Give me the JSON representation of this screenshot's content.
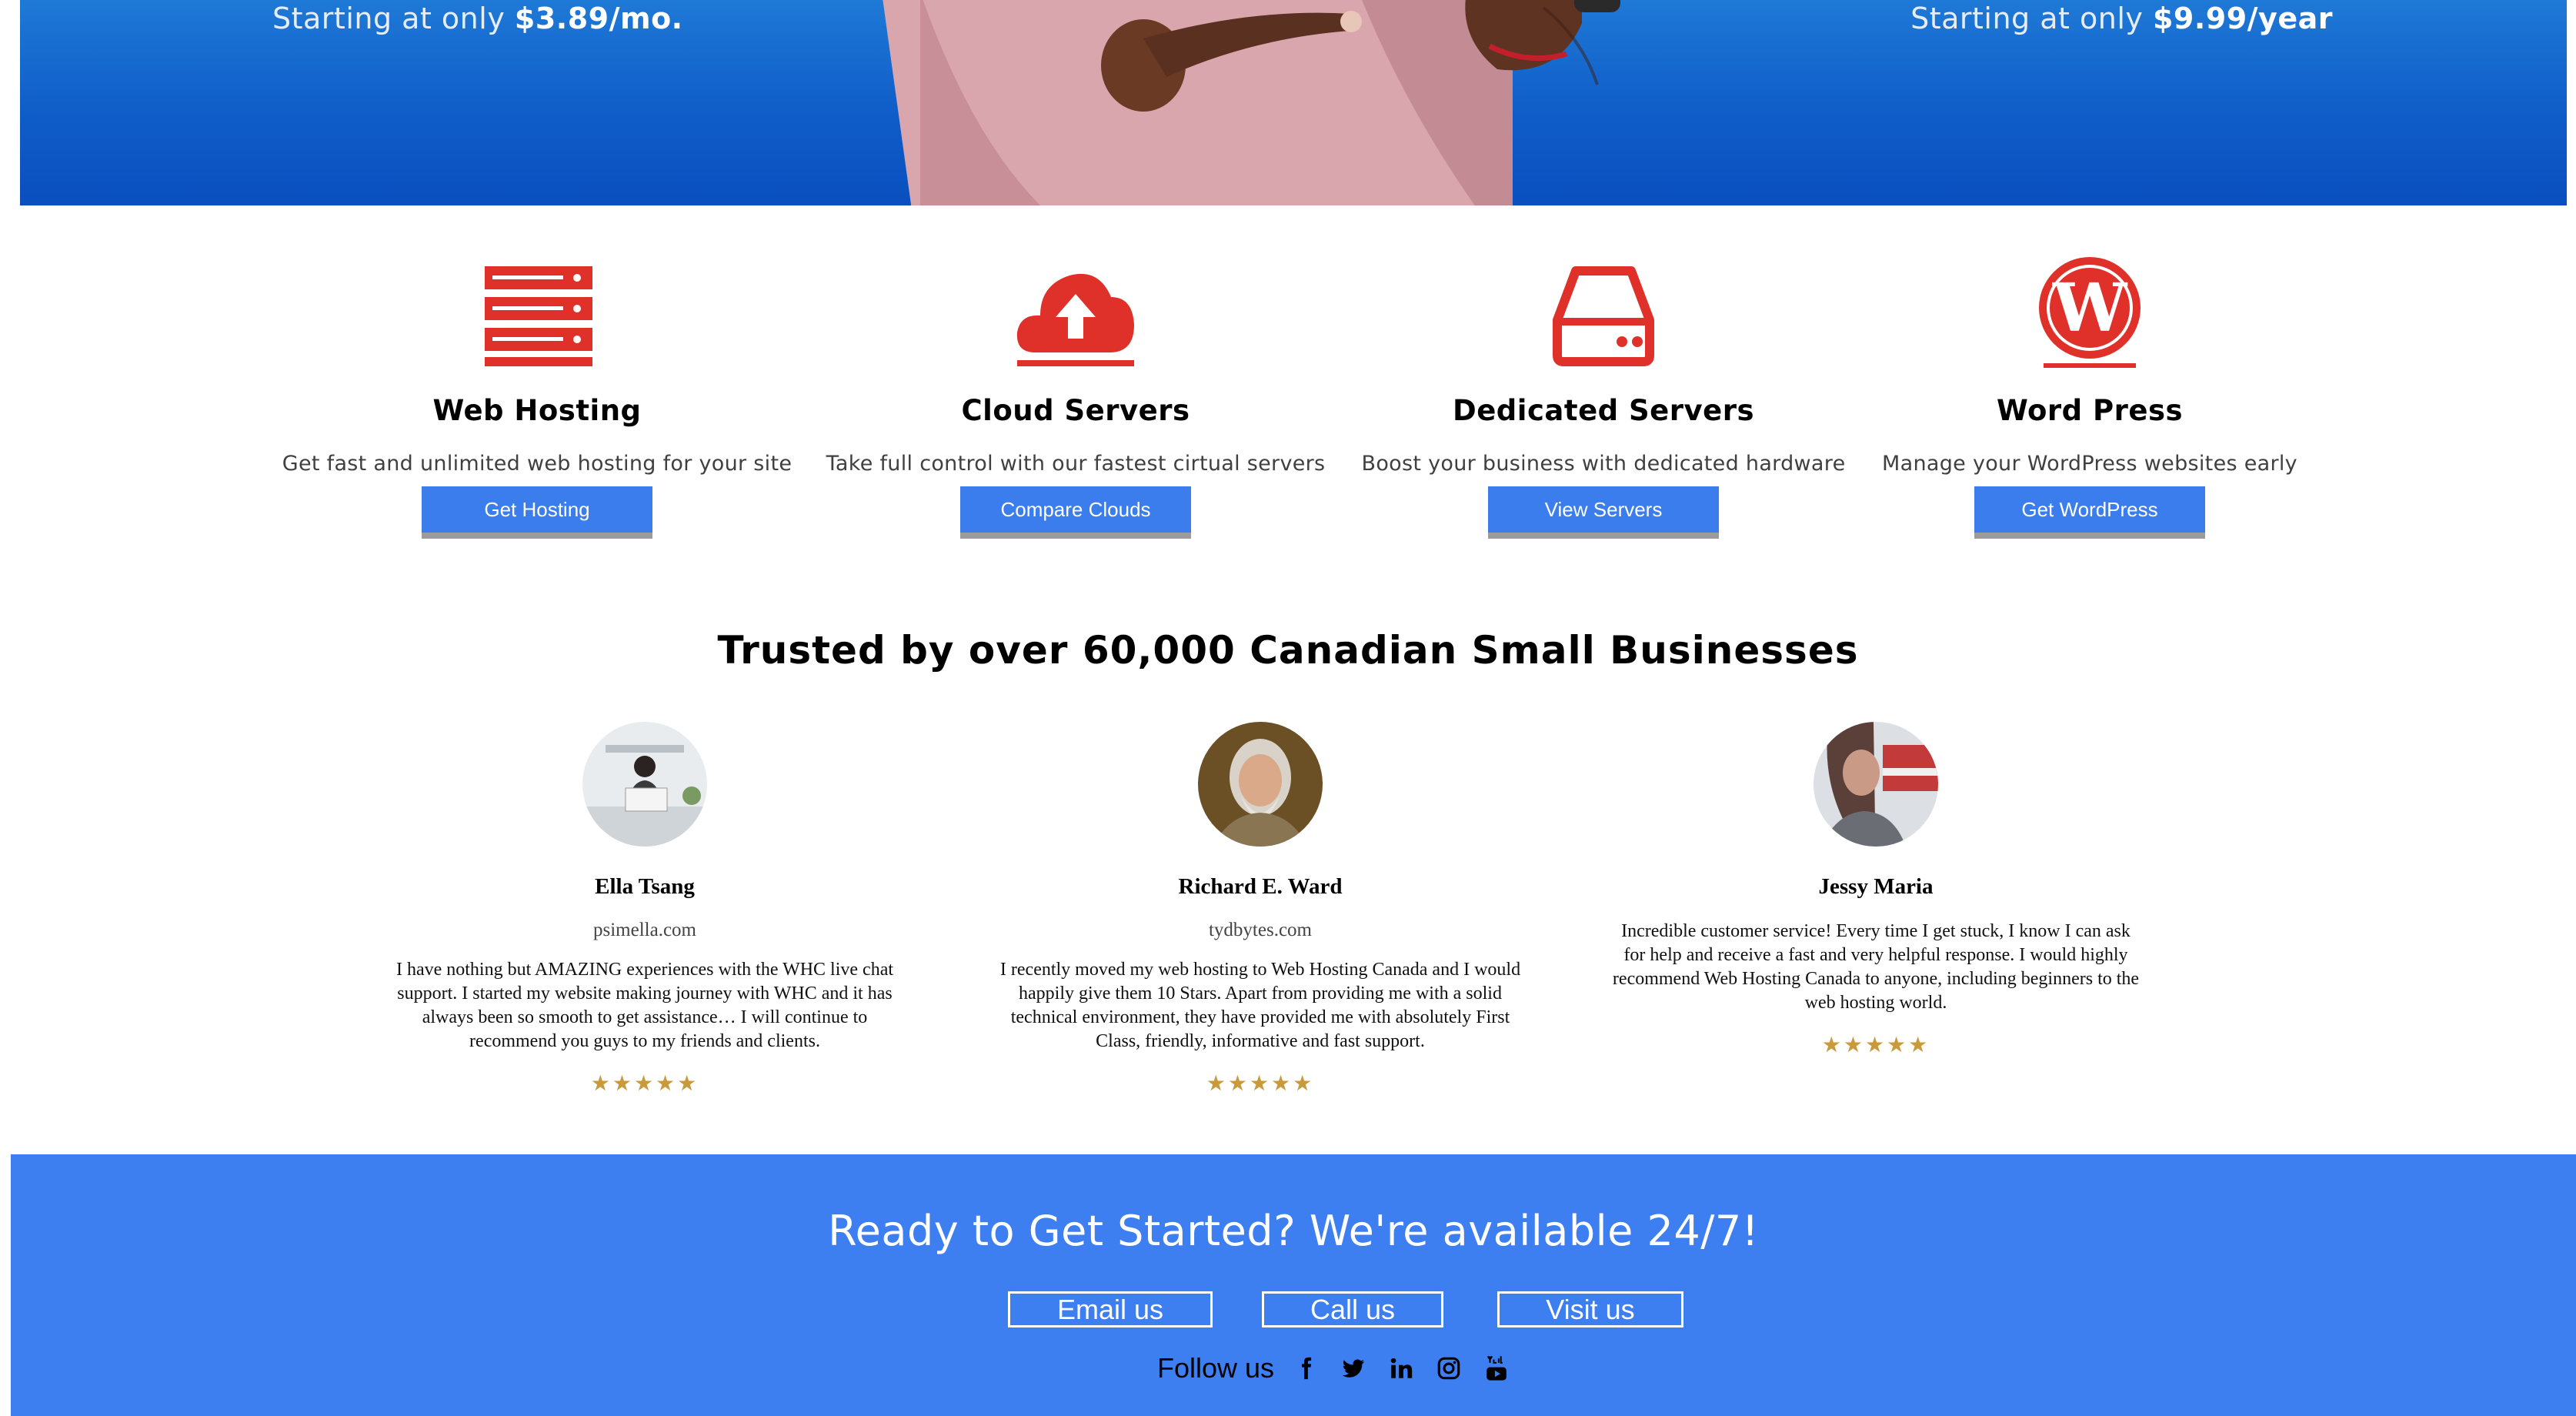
{
  "hero": {
    "left_promo_prefix": "Starting at only ",
    "left_promo_price": "$3.89/mo.",
    "right_promo_prefix": "Starting at only ",
    "right_promo_price": "$9.99/year"
  },
  "services": [
    {
      "icon": "server-rack-icon",
      "title": "Web Hosting",
      "description": "Get fast and unlimited web hosting for your site",
      "button": "Get Hosting"
    },
    {
      "icon": "cloud-upload-icon",
      "title": "Cloud Servers",
      "description": "Take full control with our fastest cirtual servers",
      "button": "Compare Clouds"
    },
    {
      "icon": "hard-drive-icon",
      "title": "Dedicated Servers",
      "description": "Boost your business with dedicated hardware",
      "button": "View Servers"
    },
    {
      "icon": "wordpress-icon",
      "title": "Word Press",
      "description": "Manage your WordPress websites early",
      "button": "Get WordPress"
    }
  ],
  "trusted": {
    "title": "Trusted by over 60,000 Canadian Small Businesses",
    "testimonials": [
      {
        "name": "Ella Tsang",
        "site": "psimella.com",
        "quote": "I have nothing but AMAZING experiences with the WHC live chat support. I started my website making journey with WHC and it has always been so smooth to get assistance… I will continue to recommend you guys to my friends and clients.",
        "stars": "★★★★★",
        "rating": 5
      },
      {
        "name": "Richard E. Ward",
        "site": "tydbytes.com",
        "quote": "I recently moved my web hosting to Web Hosting Canada and I would happily give them 10 Stars. Apart from providing me with a solid technical environment, they have provided me with absolutely First Class, friendly, informative and fast support.",
        "stars": "★★★★★",
        "rating": 5
      },
      {
        "name": "Jessy Maria",
        "site": "",
        "quote": "Incredible customer service! Every time I get stuck, I know I can ask for help and receive a fast and very helpful response. I would highly recommend Web Hosting Canada to anyone, including beginners to the web hosting world.",
        "stars": "★★★★★",
        "rating": 5
      }
    ]
  },
  "cta": {
    "title": "Ready to Get Started? We're available 24/7!",
    "email_label": "Email us",
    "call_label": "Call us",
    "visit_label": "Visit us",
    "follow_label": "Follow us",
    "social_icons": [
      "facebook-icon",
      "twitter-icon",
      "linkedin-icon",
      "instagram-icon",
      "youtube-icon"
    ]
  },
  "colors": {
    "accent_red": "#e0302a",
    "button_blue": "#3b7ded",
    "cta_blue": "#3d7ef0",
    "star_gold": "#c99a3b"
  }
}
